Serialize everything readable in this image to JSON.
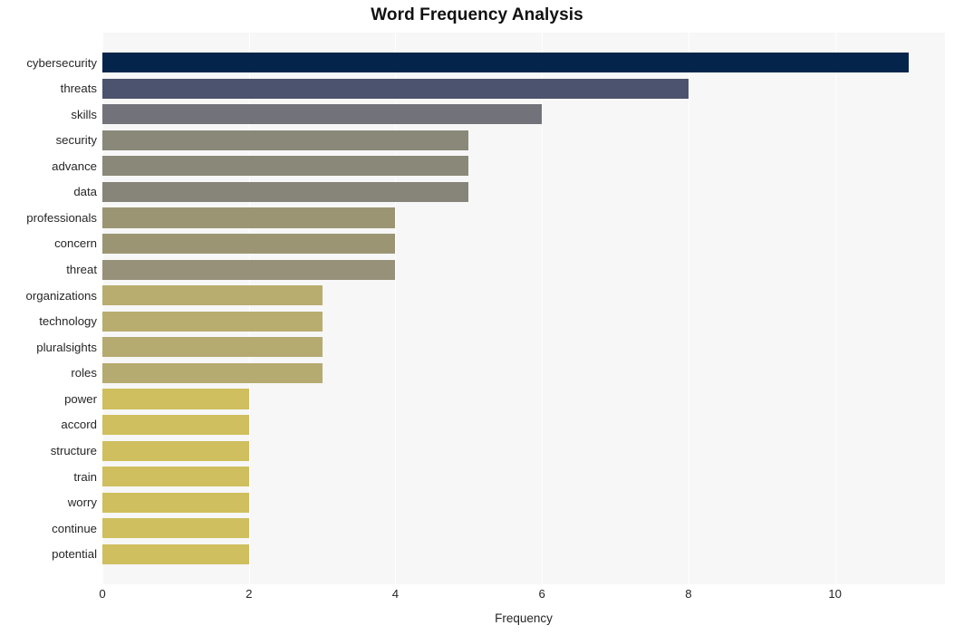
{
  "chart_data": {
    "type": "bar",
    "orientation": "horizontal",
    "title": "Word Frequency Analysis",
    "xlabel": "Frequency",
    "ylabel": "",
    "xlim": [
      0,
      11.5
    ],
    "xticks": [
      "0",
      "2",
      "4",
      "6",
      "8",
      "10"
    ],
    "xtick_values": [
      0,
      2,
      4,
      6,
      8,
      10
    ],
    "grid": "vertical-white-on-light-gray",
    "legend": "none",
    "categories": [
      "cybersecurity",
      "threats",
      "skills",
      "security",
      "advance",
      "data",
      "professionals",
      "concern",
      "threat",
      "organizations",
      "technology",
      "pluralsights",
      "roles",
      "power",
      "accord",
      "structure",
      "train",
      "worry",
      "continue",
      "potential"
    ],
    "values": [
      11,
      8,
      6,
      5,
      5,
      5,
      4,
      4,
      4,
      3,
      3,
      3,
      3,
      2,
      2,
      2,
      2,
      2,
      2,
      2
    ],
    "bar_colors": [
      "#04244b",
      "#4c536e",
      "#72737a",
      "#8a8878",
      "#8a8878",
      "#87857a",
      "#9b9573",
      "#9b9573",
      "#97917a",
      "#b8ad6e",
      "#b8ad6e",
      "#b5ab71",
      "#b5ab71",
      "#cfbf5e",
      "#cfbf5e",
      "#cfbf5e",
      "#cfbf5e",
      "#cfbf5e",
      "#cfbf5e",
      "#cfbf5e"
    ],
    "plot_background": "#f7f7f7",
    "figure_background": "#ffffff",
    "gridline_color": "#ffffff",
    "text_color": "#262626",
    "title_color": "#111111"
  }
}
